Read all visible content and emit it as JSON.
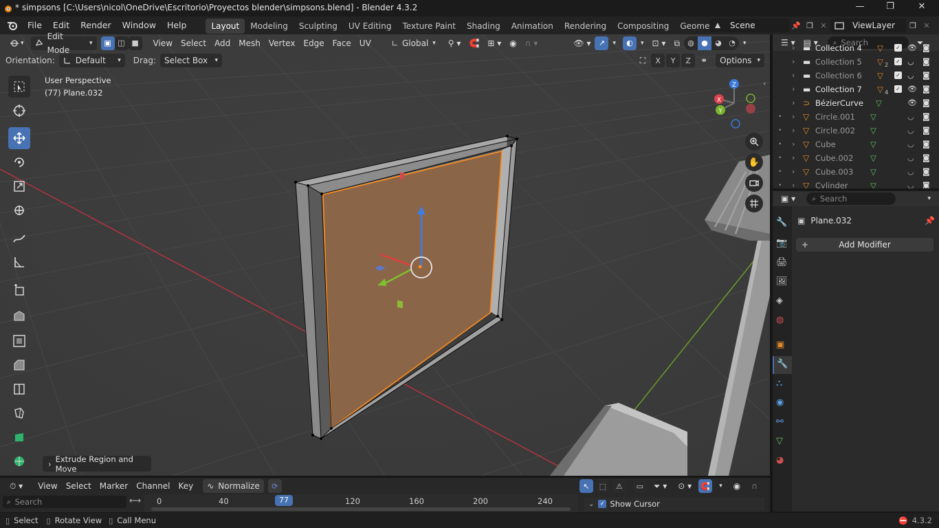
{
  "window": {
    "title": "* simpsons [C:\\Users\\nicol\\OneDrive\\Escritorio\\Proyectos blender\\simpsons.blend] - Blender 4.3.2",
    "minimize": "—",
    "maximize": "❐",
    "close": "✕"
  },
  "menu": [
    "File",
    "Edit",
    "Render",
    "Window",
    "Help"
  ],
  "workspaces": [
    "Layout",
    "Modeling",
    "Sculpting",
    "UV Editing",
    "Texture Paint",
    "Shading",
    "Animation",
    "Rendering",
    "Compositing",
    "Geometry Node"
  ],
  "scene": "Scene",
  "viewlayer": "ViewLayer",
  "viewport_header": {
    "mode": "Edit Mode",
    "menus": [
      "View",
      "Select",
      "Add",
      "Mesh",
      "Vertex",
      "Edge",
      "Face",
      "UV"
    ],
    "transform": "Global"
  },
  "tool_settings": {
    "orientation_label": "Orientation:",
    "orientation_value": "Default",
    "drag_label": "Drag:",
    "drag_value": "Select Box",
    "axes": [
      "X",
      "Y",
      "Z"
    ],
    "options": "Options"
  },
  "overlay_text": {
    "perspective": "User Perspective",
    "object": "(77) Plane.032"
  },
  "gizmo": {
    "x": "X",
    "y": "Y",
    "z": "Z"
  },
  "last_operator": "Extrude Region and Move",
  "outliner": {
    "search_placeholder": "Search",
    "rows": [
      {
        "name": "Collection 4",
        "dim": false
      },
      {
        "name": "Collection 5",
        "dim": true,
        "count": "2"
      },
      {
        "name": "Collection 6",
        "dim": true
      },
      {
        "name": "Collection 7",
        "dim": false,
        "count": "4"
      },
      {
        "name": "BézierCurve",
        "dim": false
      },
      {
        "name": "Circle.001",
        "dim": true
      },
      {
        "name": "Circle.002",
        "dim": true
      },
      {
        "name": "Cube",
        "dim": true
      },
      {
        "name": "Cube.002",
        "dim": true
      },
      {
        "name": "Cube.003",
        "dim": true
      },
      {
        "name": "Cylinder",
        "dim": true
      }
    ]
  },
  "properties": {
    "search_placeholder": "Search",
    "object": "Plane.032",
    "add_modifier": "Add Modifier"
  },
  "timeline": {
    "menus": [
      "View",
      "Select",
      "Marker",
      "Channel",
      "Key"
    ],
    "normalize": "Normalize",
    "search_placeholder": "Search",
    "frames": [
      "0",
      "40",
      "120",
      "160",
      "200",
      "240"
    ],
    "current_frame": "77",
    "show_cursor": "Show Cursor"
  },
  "status": {
    "select": "Select",
    "rotate": "Rotate View",
    "call_menu": "Call Menu",
    "version": "4.3.2"
  },
  "colors": {
    "accent": "#4772b3",
    "face_selected": "#8b6548",
    "edge_selected": "#ff8c1a",
    "grid": "#474747",
    "axis_x": "#b3343f",
    "axis_y": "#6a9b2a"
  }
}
